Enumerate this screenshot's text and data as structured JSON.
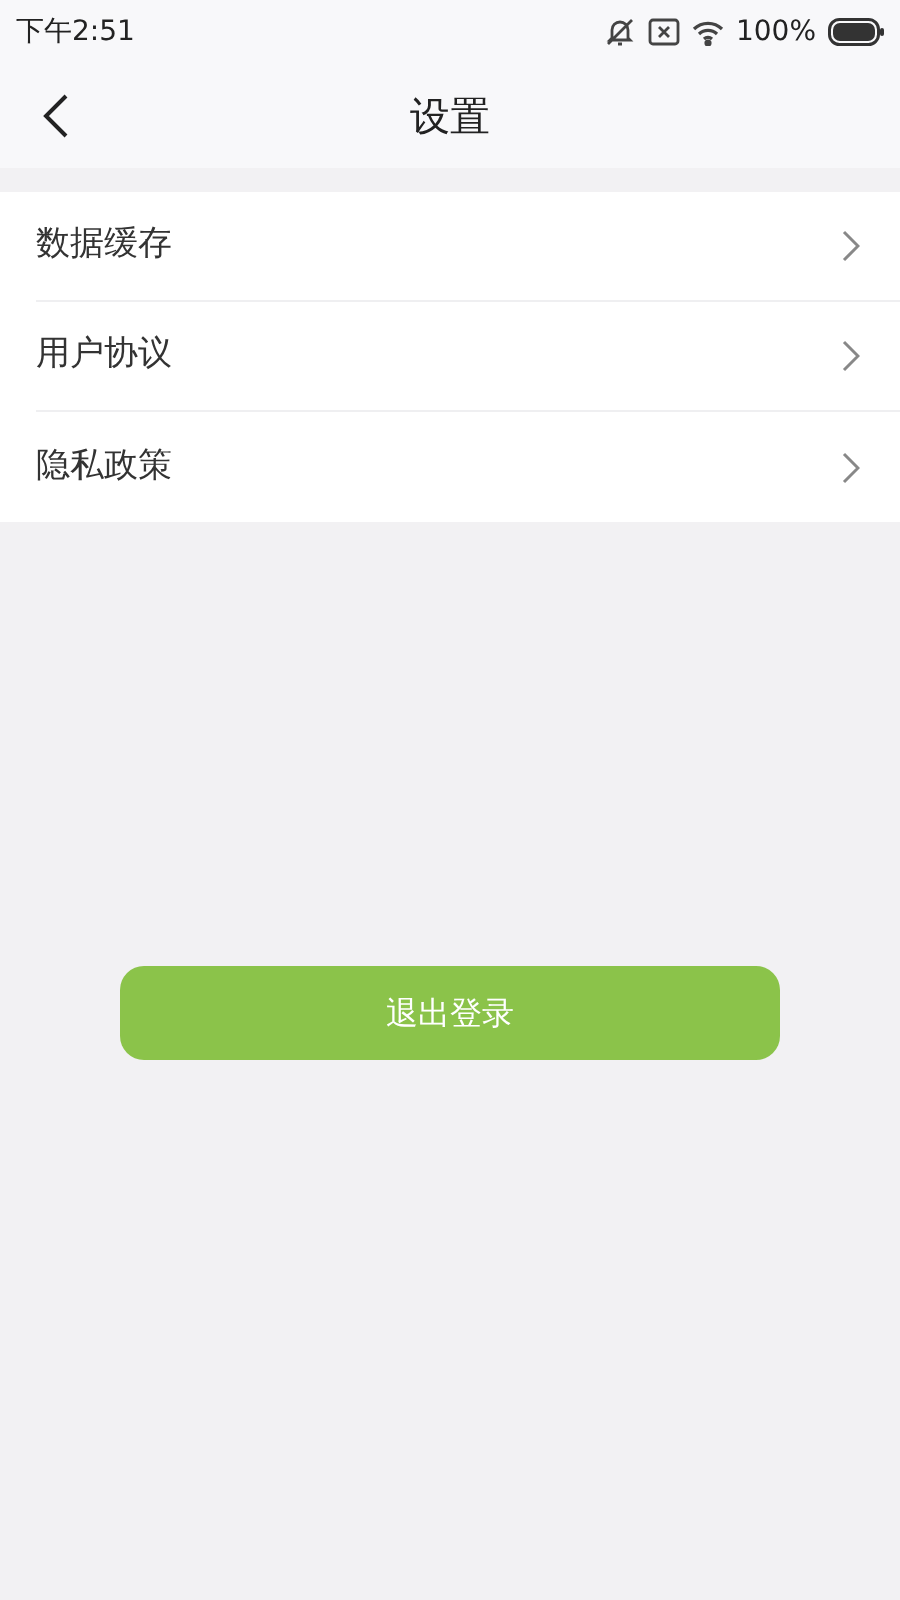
{
  "status_bar": {
    "time": "下午2:51",
    "battery": "100%"
  },
  "header": {
    "title": "设置"
  },
  "items": [
    {
      "label": "数据缓存"
    },
    {
      "label": "用户协议"
    },
    {
      "label": "隐私政策"
    }
  ],
  "logout_button": "退出登录"
}
